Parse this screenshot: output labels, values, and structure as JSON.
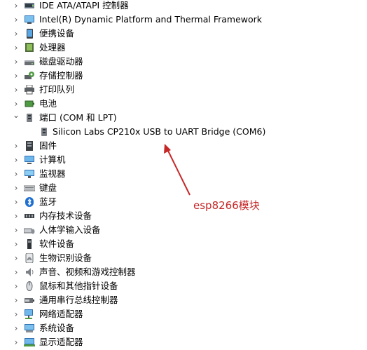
{
  "tree": {
    "items": [
      {
        "label": "IDE ATA/ATAPI 控制器",
        "icon": "ide-controller-icon",
        "expanded": false
      },
      {
        "label": "Intel(R) Dynamic Platform and Thermal Framework",
        "icon": "monitor-folder-icon",
        "expanded": false
      },
      {
        "label": "便携设备",
        "icon": "portable-device-icon",
        "expanded": false
      },
      {
        "label": "处理器",
        "icon": "processor-icon",
        "expanded": false
      },
      {
        "label": "磁盘驱动器",
        "icon": "disk-drive-icon",
        "expanded": false
      },
      {
        "label": "存储控制器",
        "icon": "storage-controller-icon",
        "expanded": false
      },
      {
        "label": "打印队列",
        "icon": "printer-icon",
        "expanded": false
      },
      {
        "label": "电池",
        "icon": "battery-icon",
        "expanded": false
      },
      {
        "label": "端口 (COM 和 LPT)",
        "icon": "port-icon",
        "expanded": true
      },
      {
        "label": "Silicon Labs CP210x USB to UART Bridge (COM6)",
        "icon": "port-icon",
        "child": true
      },
      {
        "label": "固件",
        "icon": "firmware-icon",
        "expanded": false
      },
      {
        "label": "计算机",
        "icon": "computer-icon",
        "expanded": false
      },
      {
        "label": "监视器",
        "icon": "monitor-icon",
        "expanded": false
      },
      {
        "label": "键盘",
        "icon": "keyboard-icon",
        "expanded": false
      },
      {
        "label": "蓝牙",
        "icon": "bluetooth-icon",
        "expanded": false
      },
      {
        "label": "内存技术设备",
        "icon": "memory-device-icon",
        "expanded": false
      },
      {
        "label": "人体学输入设备",
        "icon": "hid-icon",
        "expanded": false
      },
      {
        "label": "软件设备",
        "icon": "software-device-icon",
        "expanded": false
      },
      {
        "label": "生物识别设备",
        "icon": "fingerprint-icon",
        "expanded": false
      },
      {
        "label": "声音、视频和游戏控制器",
        "icon": "speaker-icon",
        "expanded": false
      },
      {
        "label": "鼠标和其他指针设备",
        "icon": "mouse-icon",
        "expanded": false
      },
      {
        "label": "通用串行总线控制器",
        "icon": "usb-icon",
        "expanded": false
      },
      {
        "label": "网络适配器",
        "icon": "network-adapter-icon",
        "expanded": false
      },
      {
        "label": "系统设备",
        "icon": "system-device-icon",
        "expanded": false
      },
      {
        "label": "显示适配器",
        "icon": "display-adapter-icon",
        "expanded": false
      }
    ]
  },
  "annotation": {
    "text": "esp8266模块",
    "color": "#c62828"
  },
  "glyphs": {
    "collapsed": "›",
    "expanded": "⌄"
  }
}
